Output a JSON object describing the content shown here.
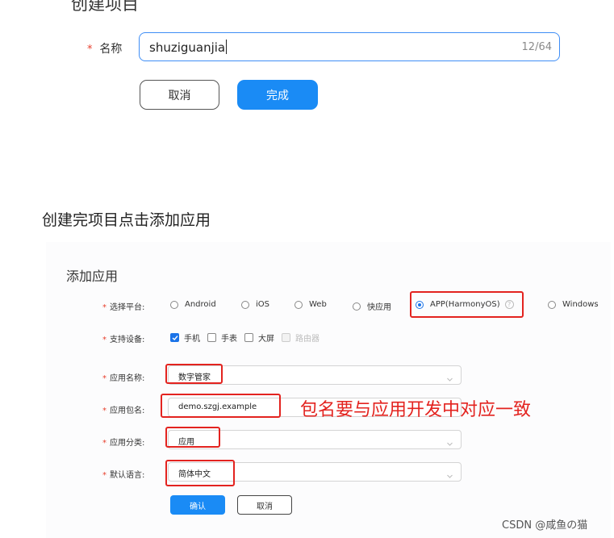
{
  "create_project": {
    "title": "创建项目",
    "name_label": "名称",
    "name_value": "shuziguanjia",
    "name_count": "12/64",
    "cancel_label": "取消",
    "done_label": "完成"
  },
  "caption": "创建完项目点击添加应用",
  "add_app": {
    "title": "添加应用",
    "platform_label": "选择平台:",
    "platforms": [
      {
        "label": "Android",
        "selected": false
      },
      {
        "label": "iOS",
        "selected": false
      },
      {
        "label": "Web",
        "selected": false
      },
      {
        "label": "快应用",
        "selected": false
      },
      {
        "label": "APP(HarmonyOS)",
        "selected": true
      },
      {
        "label": "Windows",
        "selected": false
      }
    ],
    "device_label": "支持设备:",
    "devices": [
      {
        "label": "手机",
        "checked": true,
        "disabled": false
      },
      {
        "label": "手表",
        "checked": false,
        "disabled": false
      },
      {
        "label": "大屏",
        "checked": false,
        "disabled": false
      },
      {
        "label": "路由器",
        "checked": false,
        "disabled": true
      }
    ],
    "app_name_label": "应用名称:",
    "app_name_value": "数字管家",
    "package_label": "应用包名:",
    "package_value": "demo.szgj.example",
    "category_label": "应用分类:",
    "category_value": "应用",
    "language_label": "默认语言:",
    "language_value": "简体中文",
    "confirm_label": "确认",
    "cancel_label": "取消"
  },
  "annotation": "包名要与应用开发中对应一致",
  "watermark": "CSDN @咸鱼の猫",
  "colors": {
    "primary": "#1a8bf5",
    "focus_border": "#3f8ef6",
    "annotation_red": "#e3231f",
    "required_star": "#e8402e"
  }
}
